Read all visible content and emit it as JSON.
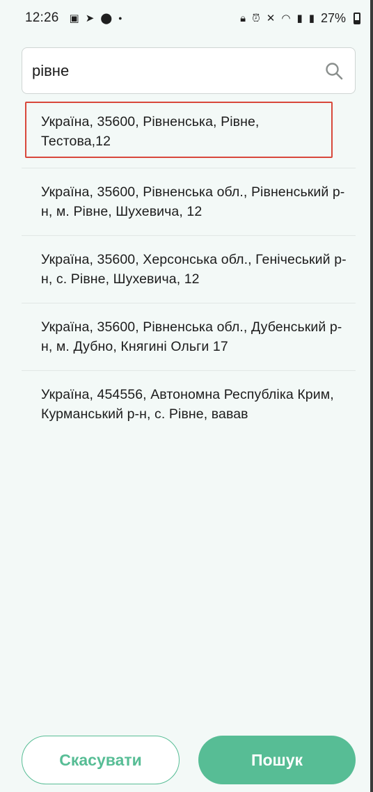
{
  "status_bar": {
    "time": "12:26",
    "left_icons": [
      "image-icon",
      "telegram-icon",
      "location-icon",
      "dot-icon"
    ],
    "right_icons": [
      "lock-icon",
      "alarm-icon",
      "mute-icon",
      "wifi-icon",
      "signal-icon",
      "signal-icon"
    ],
    "battery": "27%"
  },
  "search": {
    "value": "рівне",
    "icon": "search-icon"
  },
  "results": [
    {
      "text": "Україна, 35600, Рівненська, Рівне, Тестова,12",
      "highlighted": true
    },
    {
      "text": "Україна, 35600, Рівненська обл., Рівненський р-н, м. Рівне, Шухевича, 12",
      "highlighted": false
    },
    {
      "text": "Україна, 35600, Херсонська обл., Генічеський р-н, с. Рівне, Шухевича, 12",
      "highlighted": false
    },
    {
      "text": "Україна, 35600, Рівненська обл., Дубенський р-н, м. Дубно, Княгині Ольги 17",
      "highlighted": false
    },
    {
      "text": "Україна, 454556, Автономна Республіка Крим, Курманський р-н, с. Рівне, вавав",
      "highlighted": false
    }
  ],
  "buttons": {
    "cancel": "Скасувати",
    "search": "Пошук"
  },
  "colors": {
    "accent": "#57bd95",
    "highlight_border": "#d8483b",
    "background": "#f3f9f7"
  }
}
